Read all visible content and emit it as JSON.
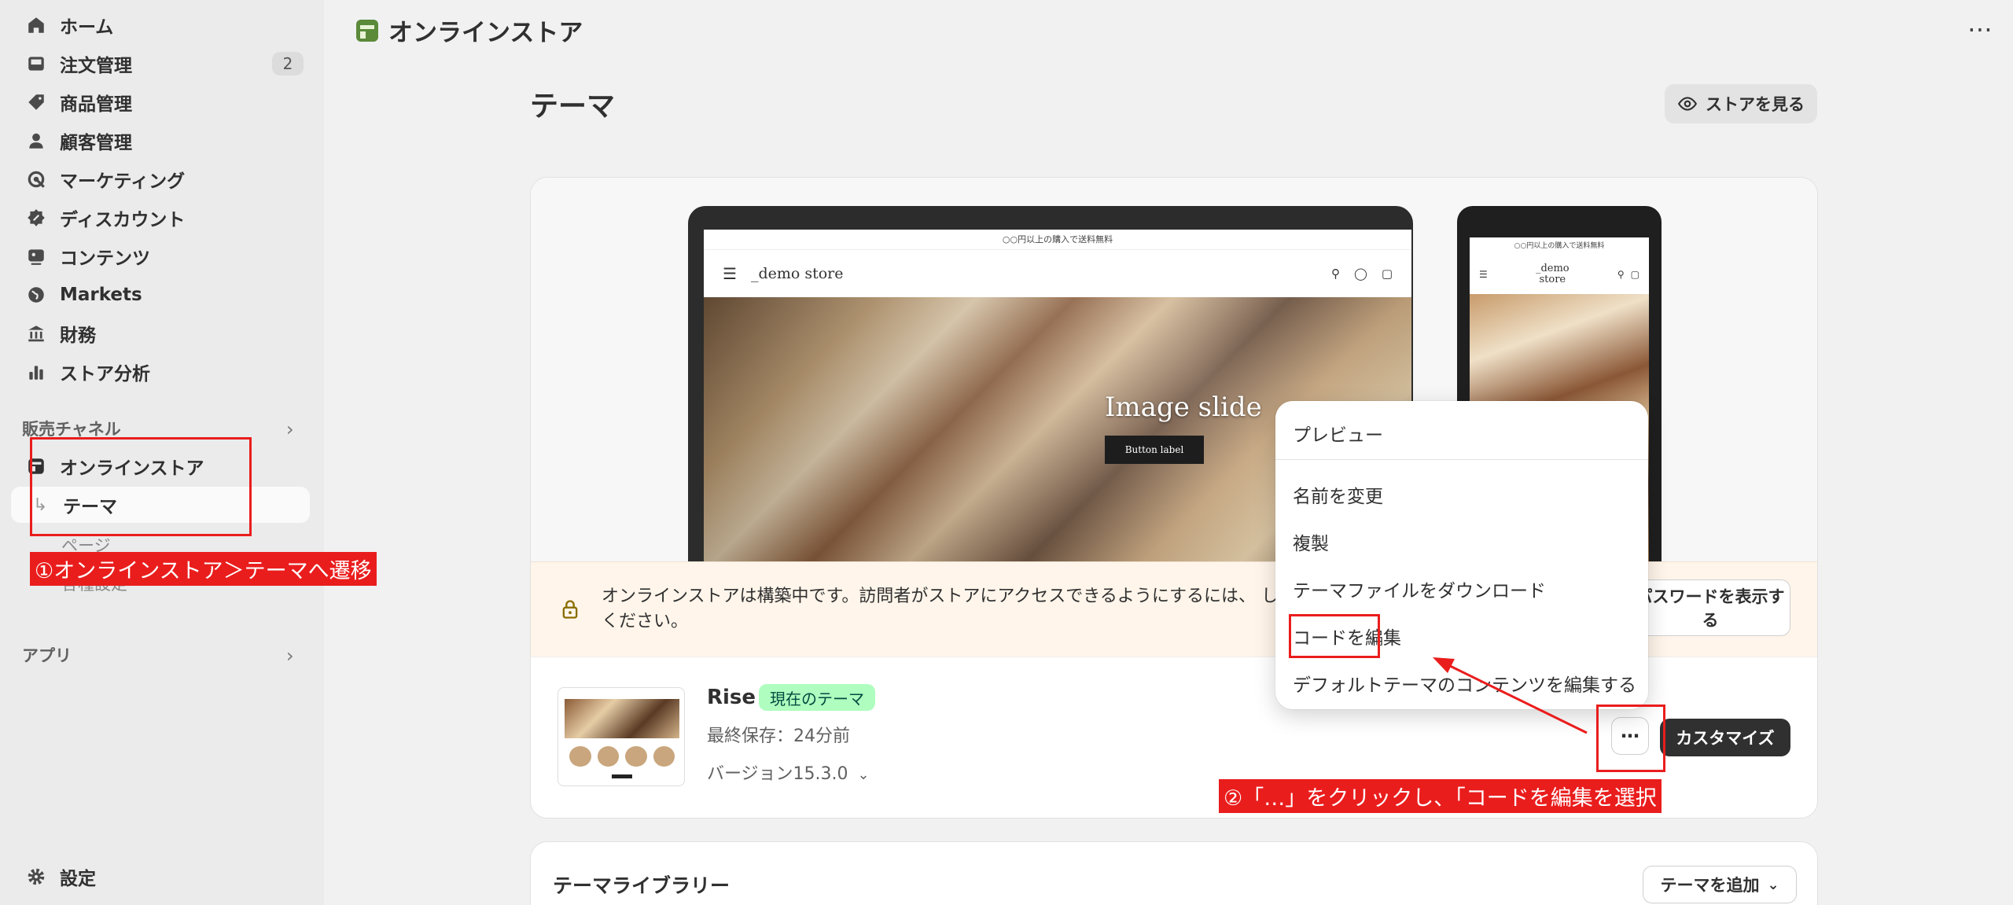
{
  "sidebar": {
    "items": [
      {
        "label": "ホーム",
        "icon": "home-icon"
      },
      {
        "label": "注文管理",
        "icon": "inbox-icon",
        "badge": "2"
      },
      {
        "label": "商品管理",
        "icon": "tag-icon"
      },
      {
        "label": "顧客管理",
        "icon": "person-icon"
      },
      {
        "label": "マーケティング",
        "icon": "target-icon"
      },
      {
        "label": "ディスカウント",
        "icon": "discount-icon"
      },
      {
        "label": "コンテンツ",
        "icon": "content-icon"
      },
      {
        "label": "Markets",
        "icon": "globe-icon"
      },
      {
        "label": "財務",
        "icon": "bank-icon"
      },
      {
        "label": "ストア分析",
        "icon": "bar-chart-icon"
      }
    ],
    "sales_channel_heading": "販売チャネル",
    "online_store": "オンラインストア",
    "themes": "テーマ",
    "pages": "ページ",
    "preferences": "各種設定",
    "apps_heading": "アプリ",
    "settings": "設定"
  },
  "header": {
    "title": "オンラインストア",
    "more": "⋯"
  },
  "page": {
    "title": "テーマ",
    "view_store": "ストアを見る"
  },
  "preview": {
    "announcement": "○○円以上の購入で送料無料",
    "store_name": "_demo store",
    "phone_store_name_line1": "_demo",
    "phone_store_name_line2": "store",
    "hero_text": "Image slide",
    "hero_button": "Button label"
  },
  "notice": {
    "text": "オンラインストアは構築中です。訪問者がストアにアクセスできるようにするには、 してください。",
    "button": "パスワードを表示する"
  },
  "theme": {
    "name": "Rise",
    "badge": "現在のテーマ",
    "last_saved": "最終保存：24分前",
    "version": "バージョン15.3.0",
    "more_button": "⋯",
    "customize": "カスタマイズ"
  },
  "menu": {
    "items": [
      "プレビュー",
      "名前を変更",
      "複製",
      "テーマファイルをダウンロード",
      "コードを編集",
      "デフォルトテーマのコンテンツを編集する"
    ]
  },
  "library": {
    "title": "テーマライブラリー",
    "add_theme": "テーマを追加"
  },
  "annotations": {
    "step1": "①オンラインストア＞テーマへ遷移",
    "step2": "②「…」をクリックし、「コードを編集を選択"
  },
  "colors": {
    "annotation": "#ea1d1d",
    "badge_bg": "#affebf",
    "primary_button": "#303030",
    "notice_bg": "#fff5ea"
  }
}
